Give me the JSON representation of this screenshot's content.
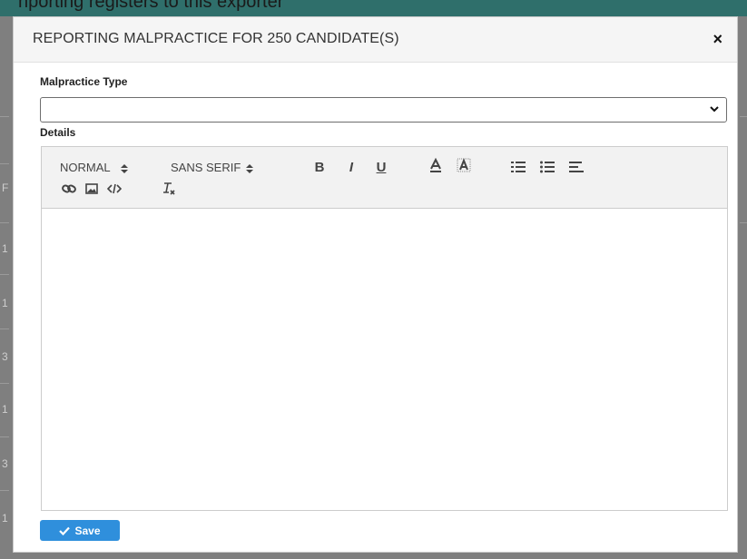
{
  "background": {
    "top_text": "nporting registers to tnis exporter",
    "edge_labels": [
      "F",
      "1",
      "1",
      "3",
      "1",
      "3",
      "1"
    ]
  },
  "modal": {
    "title": "REPORTING MALPRACTICE FOR 250 CANDIDATE(S)",
    "close_icon": "times-icon",
    "close_glyph": "×"
  },
  "form": {
    "malpractice_type": {
      "label": "Malpractice Type",
      "value": ""
    },
    "details": {
      "label": "Details",
      "toolbar": {
        "size_picker": "NORMAL",
        "font_picker": "SANS SERIF",
        "bold": "B",
        "italic": "I",
        "underline": "U",
        "font_color": "A",
        "icons": [
          "bold-icon",
          "italic-icon",
          "underline-icon",
          "text-color-icon",
          "background-color-icon",
          "ordered-list-icon",
          "bullet-list-icon",
          "align-icon",
          "link-icon",
          "image-icon",
          "code-icon",
          "clear-format-icon"
        ]
      },
      "content": ""
    }
  },
  "actions": {
    "save_label": "Save",
    "save_color": "#2f8fdc"
  }
}
